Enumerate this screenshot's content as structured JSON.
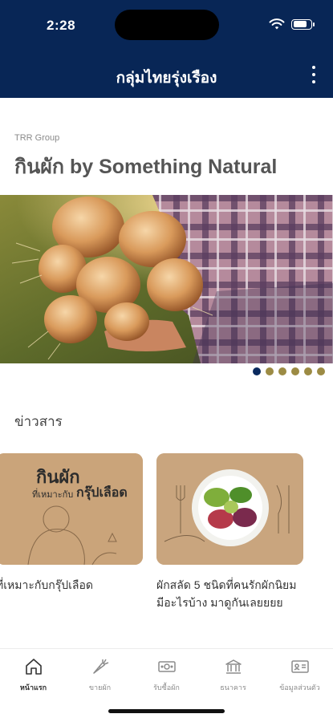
{
  "status_bar": {
    "time": "2:28"
  },
  "header": {
    "title": "กลุ่มไทยรุ่งเรือง"
  },
  "intro": {
    "group_label": "TRR Group",
    "title": "กินผัก by Something Natural"
  },
  "banner": {
    "slide_count": 6,
    "active_slide": 1
  },
  "news": {
    "heading": "ข่าวสาร",
    "items": [
      {
        "thumb_title": "กินผัก",
        "thumb_subtitle": "ที่เหมาะกับ",
        "thumb_highlight": "กรุ๊ปเลือด",
        "caption": "ที่เหมาะกับกรุ๊ปเลือด"
      },
      {
        "caption": "ผักสลัด 5 ชนิดที่คนรักผักนิยมมีอะไรบ้าง มาดูกันเลยยยย"
      }
    ]
  },
  "bottom_nav": {
    "items": [
      {
        "label": "หน้าแรก",
        "icon": "home-icon",
        "active": true
      },
      {
        "label": "ขายผัก",
        "icon": "carrot-icon",
        "active": false
      },
      {
        "label": "รับซื้อผัก",
        "icon": "money-icon",
        "active": false
      },
      {
        "label": "ธนาคาร",
        "icon": "bank-icon",
        "active": false
      },
      {
        "label": "ข้อมูลส่วนตัว",
        "icon": "id-card-icon",
        "active": false
      }
    ]
  },
  "colors": {
    "header_bg": "#082656",
    "pager_active": "#0a2a5e",
    "pager_inactive": "#9c8b44"
  }
}
